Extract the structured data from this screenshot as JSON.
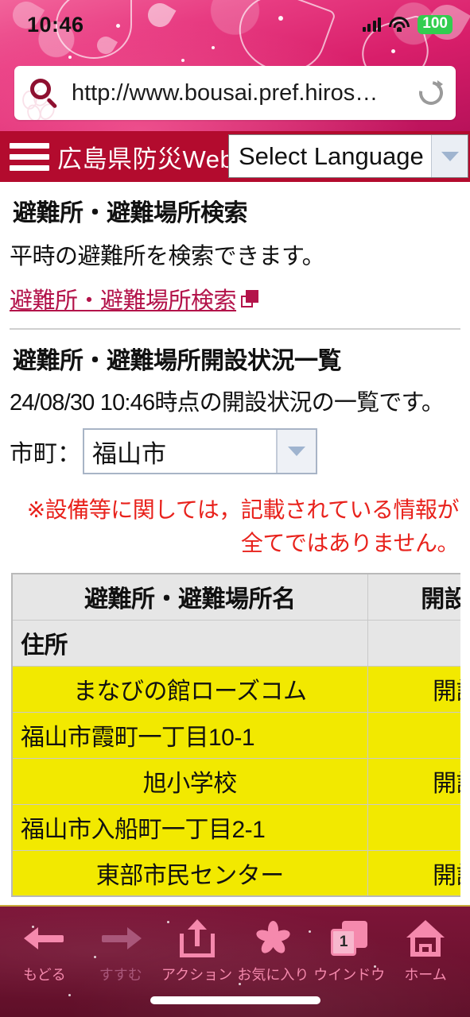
{
  "status_bar": {
    "time": "10:46",
    "battery": "100",
    "signal_icon": "cellular-signal-icon",
    "wifi_icon": "wifi-icon"
  },
  "url_bar": {
    "search_icon": "search-icon",
    "url": "http://www.bousai.pref.hiros…",
    "reload_icon": "reload-icon"
  },
  "site_nav": {
    "menu_icon": "hamburger-menu-icon",
    "title": "広島県防災Web",
    "language_select": {
      "value": "Select Language",
      "caret_icon": "chevron-down-icon"
    },
    "background_color": "#b30b2e"
  },
  "section_search": {
    "heading": "避難所・避難場所検索",
    "description": "平時の避難所を検索できます。",
    "link_label": "避難所・避難場所検索",
    "link_icon": "external-link-icon",
    "link_color": "#b3134a"
  },
  "section_status": {
    "heading": "避難所・避難場所開設状況一覧",
    "timestamp_line": "24/08/30 10:46時点の開設状況の一覧です。",
    "city_label": "市町：",
    "city_value": "福山市",
    "city_caret_icon": "chevron-down-icon",
    "notice_line1": "※設備等に関しては，記載されている情報が",
    "notice_line2": "全てではありません。",
    "notice_color": "#e8221c"
  },
  "table": {
    "header_name": "避難所・避難場所名",
    "header_status": "開設状況",
    "header_address": "住所",
    "row_highlight_color": "#f2e900",
    "rows": [
      {
        "name": "まなびの館ローズコム",
        "status": "開設中",
        "address": "福山市霞町一丁目10-1"
      },
      {
        "name": "旭小学校",
        "status": "開設中",
        "address": "福山市入船町一丁目2-1"
      },
      {
        "name": "東部市民センター",
        "status": "開設中",
        "address": ""
      }
    ]
  },
  "toolbar": {
    "items": [
      {
        "label": "もどる",
        "icon": "back-arrow-icon"
      },
      {
        "label": "すすむ",
        "icon": "forward-arrow-icon"
      },
      {
        "label": "アクション",
        "icon": "share-icon"
      },
      {
        "label": "お気に入り",
        "icon": "sakura-bookmark-icon"
      },
      {
        "label": "ウインドウ",
        "icon": "windows-icon",
        "badge": "1"
      },
      {
        "label": "ホーム",
        "icon": "home-icon"
      }
    ]
  }
}
